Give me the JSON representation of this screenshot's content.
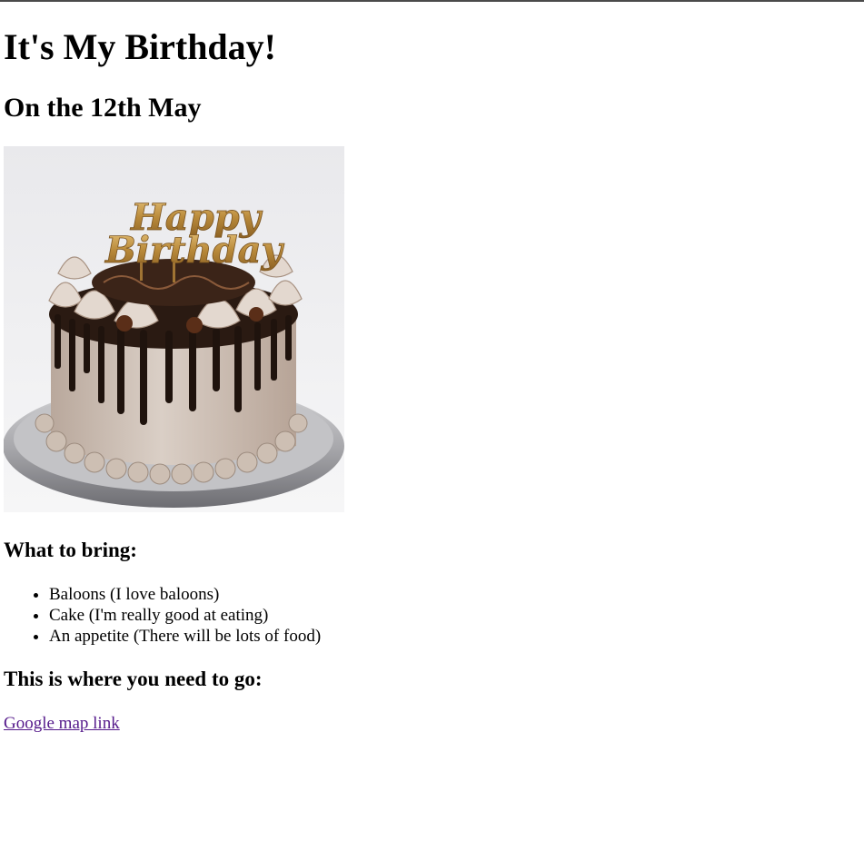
{
  "heading": "It's My Birthday!",
  "subheading": "On the 12th May",
  "cake_image": {
    "topper_text": "Happy Birthday"
  },
  "bring": {
    "title": "What to bring:",
    "items": [
      "Baloons (I love baloons)",
      "Cake (I'm really good at eating)",
      "An appetite (There will be lots of food)"
    ]
  },
  "location": {
    "title": "This is where you need to go:",
    "link_text": "Google map link"
  },
  "colors": {
    "visited_link": "#551a8b",
    "text": "#000000",
    "background": "#ffffff"
  }
}
